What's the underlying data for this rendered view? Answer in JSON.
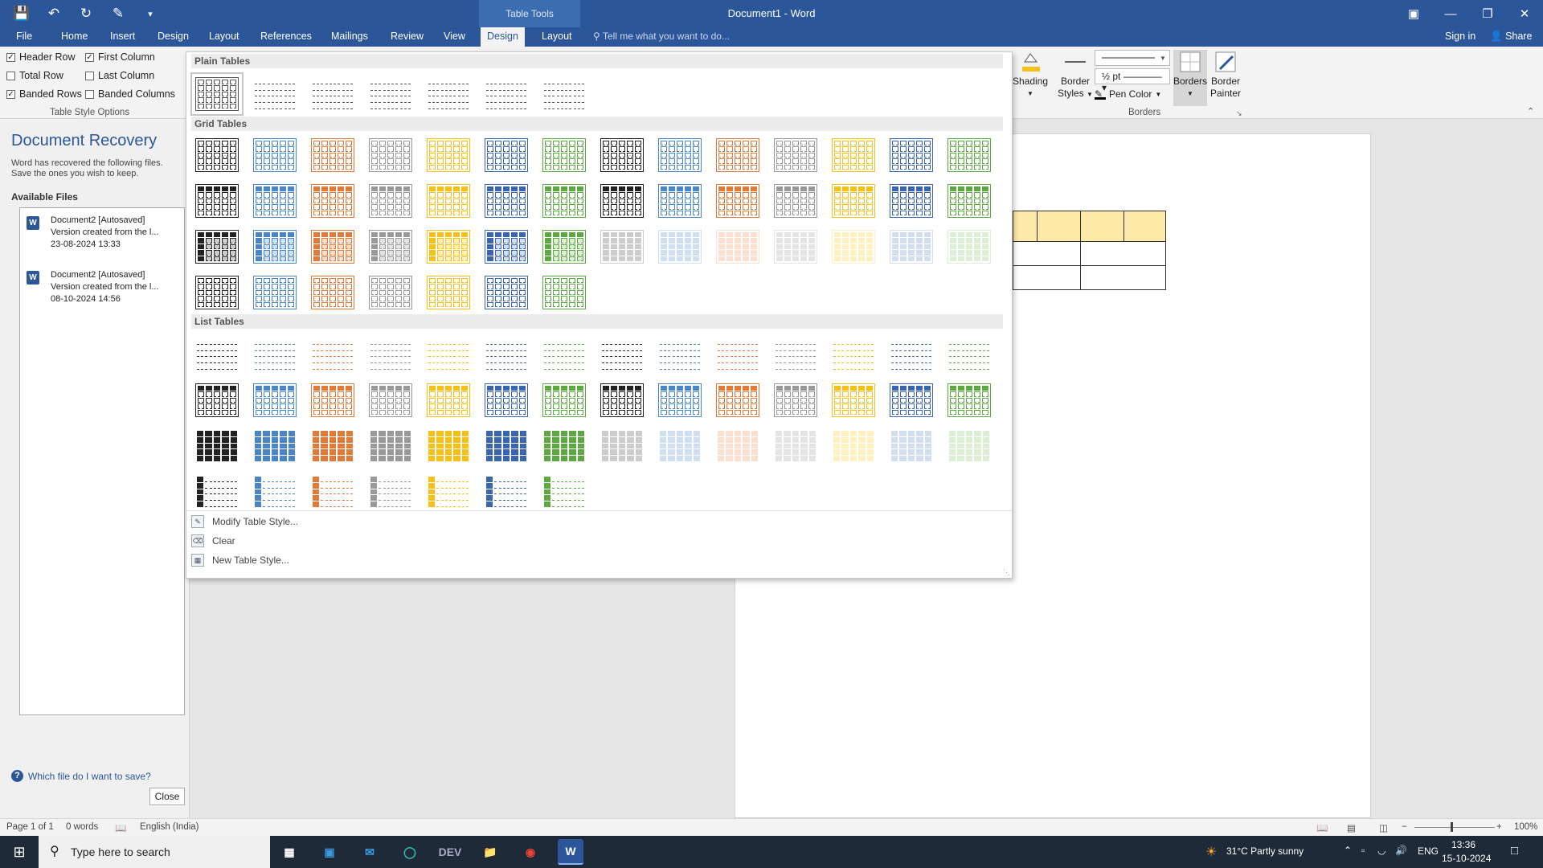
{
  "titlebar": {
    "context_tab": "Table Tools",
    "document_title": "Document1 - Word"
  },
  "tabs": [
    {
      "label": "File"
    },
    {
      "label": "Home"
    },
    {
      "label": "Insert"
    },
    {
      "label": "Design"
    },
    {
      "label": "Layout"
    },
    {
      "label": "References"
    },
    {
      "label": "Mailings"
    },
    {
      "label": "Review"
    },
    {
      "label": "View"
    },
    {
      "label": "Design"
    },
    {
      "label": "Layout"
    }
  ],
  "tell_me": "Tell me what you want to do...",
  "sign_in": "Sign in",
  "share": "Share",
  "table_style_options": {
    "header_row": "Header Row",
    "first_column": "First Column",
    "total_row": "Total Row",
    "last_column": "Last Column",
    "banded_rows": "Banded Rows",
    "banded_columns": "Banded Columns",
    "group_label": "Table Style Options"
  },
  "borders_group": {
    "shading": "Shading",
    "border": "Border",
    "styles": "Styles",
    "weight": "½ pt",
    "pen_color": "Pen Color",
    "borders": "Borders",
    "border2": "Border",
    "painter": "Painter",
    "group_label": "Borders"
  },
  "gallery": {
    "plain_tables": "Plain Tables",
    "grid_tables": "Grid Tables",
    "list_tables": "List Tables",
    "modify": "Modify Table Style...",
    "clear": "Clear",
    "new_style": "New Table Style...",
    "palette": [
      "#222222",
      "#4a86c5",
      "#e07b39",
      "#999999",
      "#f5c116",
      "#3a66b0",
      "#5ea843"
    ],
    "light_palette": [
      "#cccccc",
      "#cfe0f3",
      "#fbe0cf",
      "#e4e4e4",
      "#fff0c0",
      "#d3def0",
      "#dceed3"
    ]
  },
  "recovery": {
    "title": "Document Recovery",
    "description": "Word has recovered the following files. Save the ones you wish to keep.",
    "available": "Available Files",
    "files": [
      {
        "name": "Document2  [Autosaved]",
        "detail": "Version created from the l...",
        "date": "23-08-2024 13:33"
      },
      {
        "name": "Document2  [Autosaved]",
        "detail": "Version created from the l...",
        "date": "08-10-2024 14:56"
      }
    ],
    "which_file": "Which file do I want to save?",
    "close": "Close"
  },
  "statusbar": {
    "page": "Page 1 of 1",
    "words": "0 words",
    "language": "English (India)",
    "zoom": "100%"
  },
  "taskbar": {
    "search_placeholder": "Type here to search",
    "weather": "31°C  Partly sunny",
    "lang": "ENG",
    "time": "13:36",
    "date": "15-10-2024"
  }
}
